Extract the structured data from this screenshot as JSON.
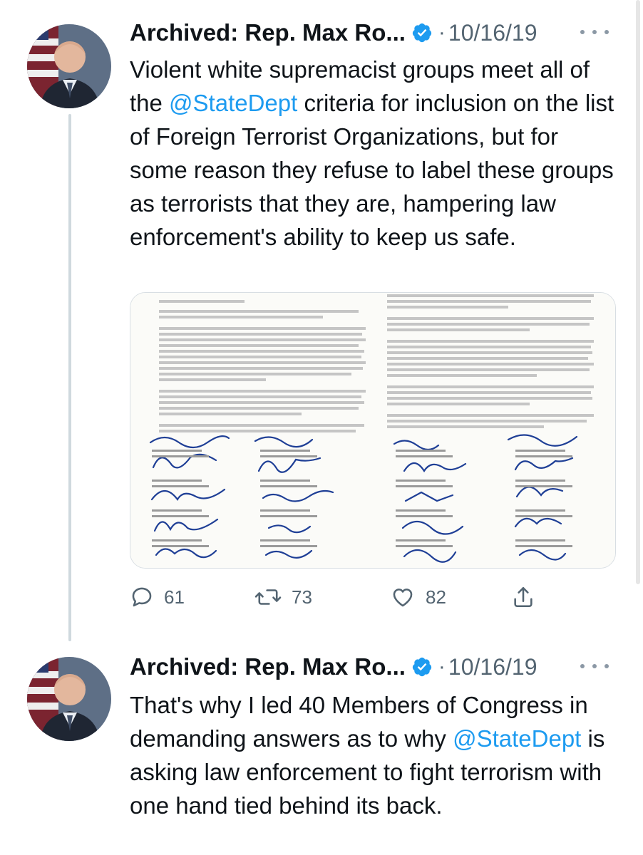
{
  "colors": {
    "accent": "#1d9bf0",
    "text_primary": "#0f1419",
    "text_secondary": "#536471",
    "thread_line": "#cfd9de"
  },
  "tweets": [
    {
      "author_name": "Archived: Rep. Max Ro...",
      "separator": "·",
      "date": "10/16/19",
      "text_segments": [
        "Violent white supremacist groups meet all of the ",
        "@StateDept",
        " criteria for inclusion on the list of Foreign Terrorist Organizations, but for some reason they refuse to label these groups as terrorists that they are, hampering law enforcement's ability to keep us safe."
      ],
      "reply_count": "61",
      "retweet_count": "73",
      "like_count": "82",
      "media_description_icons": [
        "letter-page-left",
        "letter-page-right",
        "signature-block"
      ]
    },
    {
      "author_name": "Archived: Rep. Max Ro...",
      "separator": "·",
      "date": "10/16/19",
      "text_segments": [
        "That's why I led 40 Members of Congress in demanding answers as to why ",
        "@StateDept",
        " is asking law enforcement to fight terrorism with one hand tied behind its back."
      ]
    }
  ],
  "icons": {
    "verified": "verified-badge-icon",
    "more": "more-options-icon",
    "reply": "reply-icon",
    "retweet": "retweet-icon",
    "like": "heart-icon",
    "share": "share-icon"
  }
}
